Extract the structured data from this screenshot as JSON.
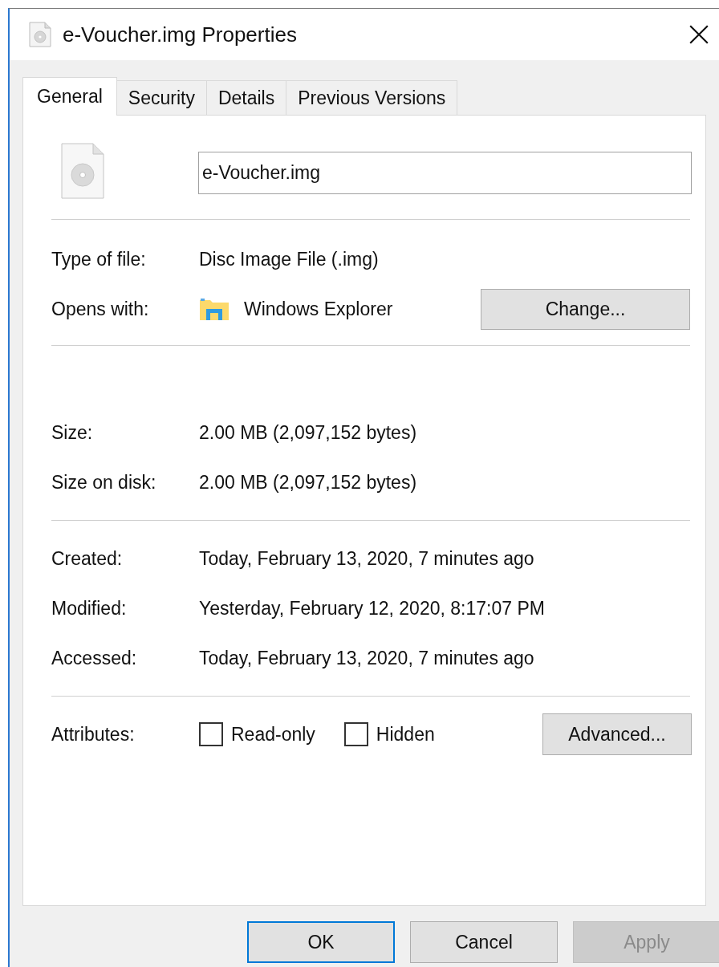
{
  "window": {
    "title": "e-Voucher.img Properties"
  },
  "tabs": [
    {
      "label": "General",
      "selected": true
    },
    {
      "label": "Security",
      "selected": false
    },
    {
      "label": "Details",
      "selected": false
    },
    {
      "label": "Previous Versions",
      "selected": false
    }
  ],
  "file_name": {
    "value": "e-Voucher.img"
  },
  "file_info": {
    "type_label": "Type of file:",
    "type_value": "Disc Image File (.img)",
    "opens_label": "Opens with:",
    "opens_value": "Windows Explorer",
    "change_button": "Change..."
  },
  "size": [
    {
      "label": "Size:",
      "value": "2.00 MB (2,097,152 bytes)"
    },
    {
      "label": "Size on disk:",
      "value": "2.00 MB (2,097,152 bytes)"
    }
  ],
  "dates": [
    {
      "label": "Created:",
      "value": "Today, February 13, 2020, 7 minutes ago"
    },
    {
      "label": "Modified:",
      "value": "Yesterday, February 12, 2020, 8:17:07 PM"
    },
    {
      "label": "Accessed:",
      "value": "Today, February 13, 2020, 7 minutes ago"
    }
  ],
  "attributes": {
    "label": "Attributes:",
    "checkboxes": [
      {
        "label": "Read-only",
        "checked": false
      },
      {
        "label": "Hidden",
        "checked": false
      }
    ],
    "advanced_button": "Advanced..."
  },
  "buttons": [
    {
      "label": "OK",
      "default": true,
      "disabled": false
    },
    {
      "label": "Cancel",
      "default": false,
      "disabled": false
    },
    {
      "label": "Apply",
      "default": false,
      "disabled": true
    }
  ]
}
